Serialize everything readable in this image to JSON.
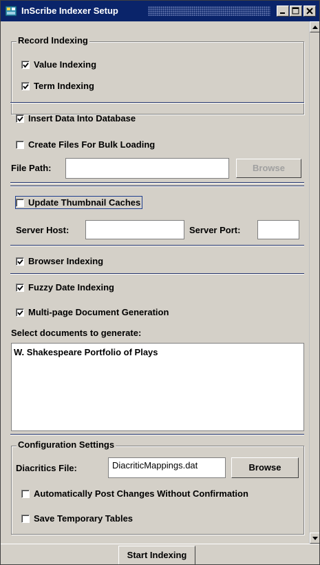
{
  "window": {
    "title": "InScribe Indexer Setup"
  },
  "record_indexing": {
    "legend": "Record Indexing",
    "value_indexing": {
      "label": "Value Indexing",
      "checked": true
    },
    "term_indexing": {
      "label": "Term Indexing",
      "checked": true
    }
  },
  "database": {
    "insert_data": {
      "label": "Insert Data Into Database",
      "checked": true
    },
    "bulk_files": {
      "label": "Create Files For Bulk Loading",
      "checked": false
    },
    "file_path_label": "File Path:",
    "file_path_value": "",
    "browse_label": "Browse"
  },
  "thumbnails": {
    "update_caches": {
      "label": "Update Thumbnail Caches",
      "checked": false
    },
    "server_host_label": "Server Host:",
    "server_host_value": "",
    "server_port_label": "Server Port:",
    "server_port_value": ""
  },
  "browser": {
    "label": "Browser Indexing",
    "checked": true
  },
  "documents": {
    "fuzzy_date": {
      "label": "Fuzzy Date Indexing",
      "checked": true
    },
    "multipage": {
      "label": "Multi-page Document Generation",
      "checked": true
    },
    "select_label": "Select documents to generate:",
    "items": [
      "W. Shakespeare Portfolio of Plays"
    ]
  },
  "configuration": {
    "legend": "Configuration Settings",
    "diacritics_label": "Diacritics File:",
    "diacritics_value": "DiacriticMappings.dat",
    "browse_label": "Browse",
    "auto_post": {
      "label": "Automatically Post Changes Without Confirmation",
      "checked": false
    },
    "save_temp": {
      "label": "Save Temporary Tables",
      "checked": false
    }
  },
  "start_button": "Start Indexing",
  "colors": {
    "titlebar": "#0a246a",
    "panel": "#d4d0c8",
    "separator": "#1f2f66"
  },
  "icons": [
    "app-icon",
    "minimize-icon",
    "maximize-icon",
    "close-icon",
    "scroll-up-icon",
    "scroll-down-icon",
    "checkmark-icon"
  ]
}
